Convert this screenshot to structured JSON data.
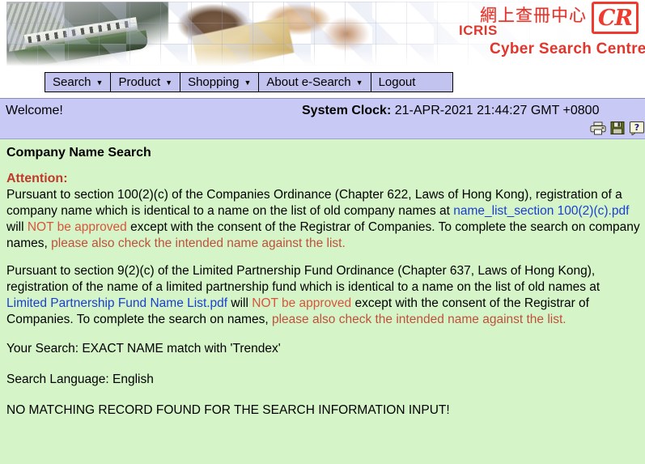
{
  "banner": {
    "logo_chinese": "網上查冊中心",
    "logo_icris": "ICRIS",
    "logo_subtitle": "Cyber Search Centre",
    "logo_mark": "CR"
  },
  "nav": {
    "items": [
      {
        "label": "Search",
        "has_dropdown": true
      },
      {
        "label": "Product",
        "has_dropdown": true
      },
      {
        "label": "Shopping",
        "has_dropdown": true
      },
      {
        "label": "About e-Search",
        "has_dropdown": true
      },
      {
        "label": "Logout",
        "has_dropdown": false
      }
    ],
    "caret_glyph": "▼"
  },
  "statusbar": {
    "welcome": "Welcome!",
    "clock_label": "System Clock:",
    "clock_value": "21-APR-2021 21:44:27 GMT +0800",
    "icons": [
      {
        "name": "print-icon",
        "title": "Print"
      },
      {
        "name": "save-icon",
        "title": "Save"
      },
      {
        "name": "help-icon",
        "title": "Help"
      }
    ]
  },
  "main": {
    "title": "Company Name Search",
    "attention_label": "Attention:",
    "paragraph1": {
      "part1": "Pursuant to section 100(2)(c) of the Companies Ordinance (Chapter 622, Laws of Hong Kong), registration of a company name which is identical to a name on the list of old company names at ",
      "link": "name_list_section 100(2)(c).pdf",
      "part2": " will ",
      "warn": "NOT be approved",
      "part3": " except with the consent of the Registrar of Companies. To complete the search on company names, ",
      "notice": "please also check the intended name against the list."
    },
    "paragraph2": {
      "part1": "Pursuant to section 9(2)(c) of the Limited Partnership Fund Ordinance (Chapter 637, Laws of Hong Kong), registration of the name of a limited partnership fund which is identical to a name on the list of old names at ",
      "link": "Limited Partnership Fund Name List.pdf",
      "part2": " will ",
      "warn": "NOT be approved",
      "part3": " except with the consent of the Registrar of Companies. To complete the search on names, ",
      "notice": "please also check the intended name against the list."
    },
    "your_search": "Your Search: EXACT NAME match with 'Trendex'",
    "search_language": "Search Language: English",
    "result_message": "NO MATCHING RECORD FOUND FOR THE SEARCH INFORMATION INPUT!"
  },
  "colors": {
    "nav_bg": "#c3c3f0",
    "status_bg": "#c9c9f5",
    "content_bg": "#d5f5c8",
    "brand_red": "#e2352c",
    "attention_red": "#c0392b",
    "warn_red": "#d8543c",
    "link_blue": "#1a3fd0"
  }
}
